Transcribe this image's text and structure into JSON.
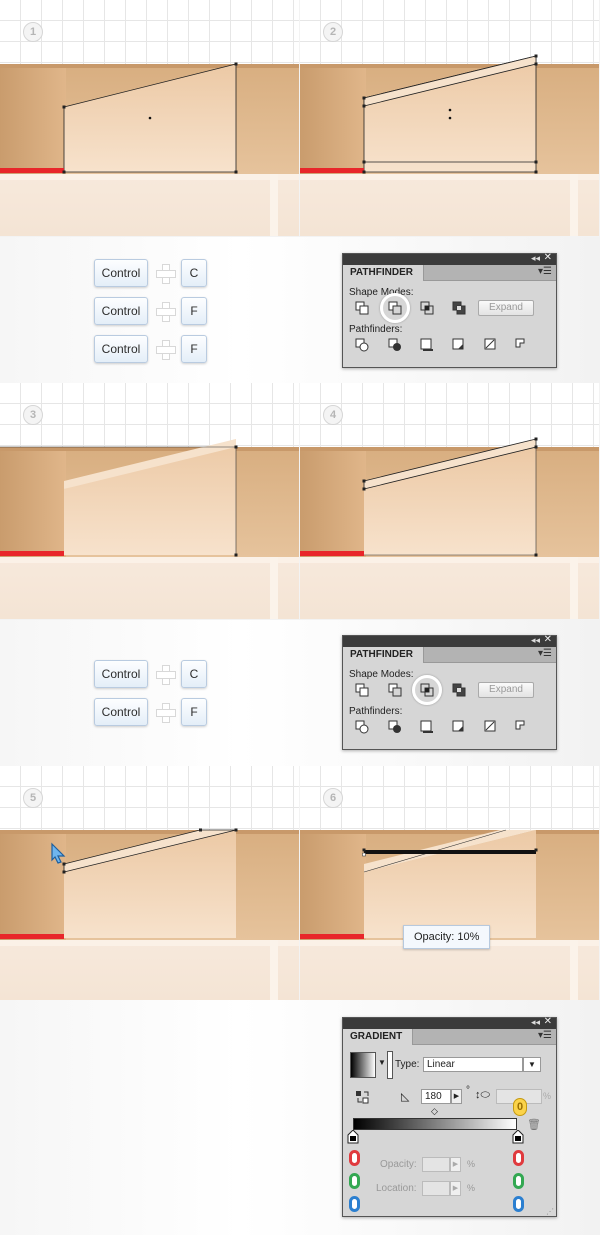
{
  "steps": [
    "1",
    "2",
    "3",
    "4",
    "5",
    "6"
  ],
  "shortcuts_group_1": [
    {
      "modifier": "Control",
      "key": "C"
    },
    {
      "modifier": "Control",
      "key": "F"
    },
    {
      "modifier": "Control",
      "key": "F"
    }
  ],
  "shortcuts_group_2": [
    {
      "modifier": "Control",
      "key": "C"
    },
    {
      "modifier": "Control",
      "key": "F"
    }
  ],
  "pathfinder": {
    "title": "PATHFINDER",
    "shape_modes_label": "Shape Modes:",
    "pathfinders_label": "Pathfinders:",
    "expand_label": "Expand",
    "highlighted_mode_panel_1": "minus-front",
    "highlighted_mode_panel_2": "intersect"
  },
  "opacity_tooltip": "Opacity: 10%",
  "gradient": {
    "title": "GRADIENT",
    "type_label": "Type:",
    "type_value": "Linear",
    "angle_value": "180",
    "degree_symbol": "°",
    "percent_symbol": "%",
    "opacity_label": "Opacity:",
    "location_label": "Location:",
    "aspect_marker": "0",
    "color_stop_values": [
      "0",
      "0",
      "0",
      "0",
      "0",
      "0"
    ]
  },
  "colors": {
    "tan_dark": "#d4a373",
    "tan_light": "#f2d6b8",
    "highlight": "#f6e2cc",
    "red_strip": "#e8262a",
    "floor": "#f5e8da",
    "rgb_red": "#e03a3e",
    "rgb_green": "#33a852",
    "rgb_blue": "#2b7fd0",
    "key_border": "#b9cbe0"
  }
}
